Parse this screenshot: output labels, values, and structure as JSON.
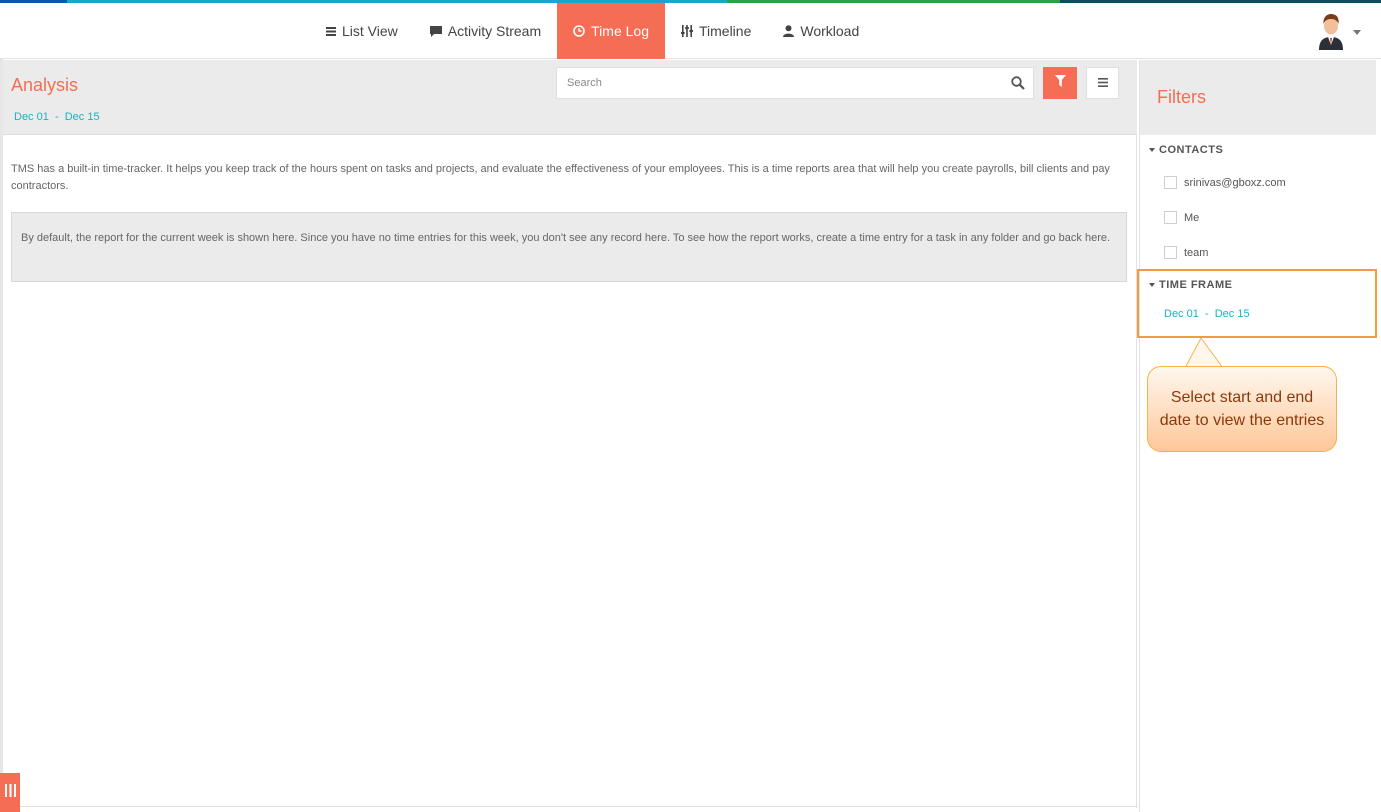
{
  "topbar": {
    "stripe_colors": [
      "#0d58a6",
      "#1aa6c9",
      "#2ea043",
      "#0b4f5c"
    ]
  },
  "nav": {
    "items": [
      {
        "label": "List View",
        "icon": "list-icon",
        "active": false
      },
      {
        "label": "Activity Stream",
        "icon": "comment-icon",
        "active": false
      },
      {
        "label": "Time Log",
        "icon": "clock-icon",
        "active": true
      },
      {
        "label": "Timeline",
        "icon": "sliders-icon",
        "active": false
      },
      {
        "label": "Workload",
        "icon": "user-icon",
        "active": false
      }
    ],
    "accent_color": "#f56d54"
  },
  "header": {
    "title": "Analysis",
    "date_range": "Dec 01  -  Dec 15",
    "search_placeholder": "Search"
  },
  "main": {
    "intro": "TMS has a built-in time-tracker. It helps you keep track of the hours spent on tasks and projects, and evaluate the effectiveness of your employees. This is a time reports area that will help you create payrolls, bill clients and pay contractors.",
    "notice": "By default, the report for the current week is shown here. Since you have no time entries for this week, you don't see any record here. To see how the report works, create a time entry for a task in any folder and go back here."
  },
  "sidebar": {
    "title": "Filters",
    "contacts_heading": "CONTACTS",
    "contacts": [
      "srinivas@gboxz.com",
      "Me",
      "team"
    ],
    "timeframe_heading": "TIME FRAME",
    "timeframe_value": "Dec 01  -  Dec 15"
  },
  "callout": {
    "text": "Select start and end date to view the entries"
  }
}
